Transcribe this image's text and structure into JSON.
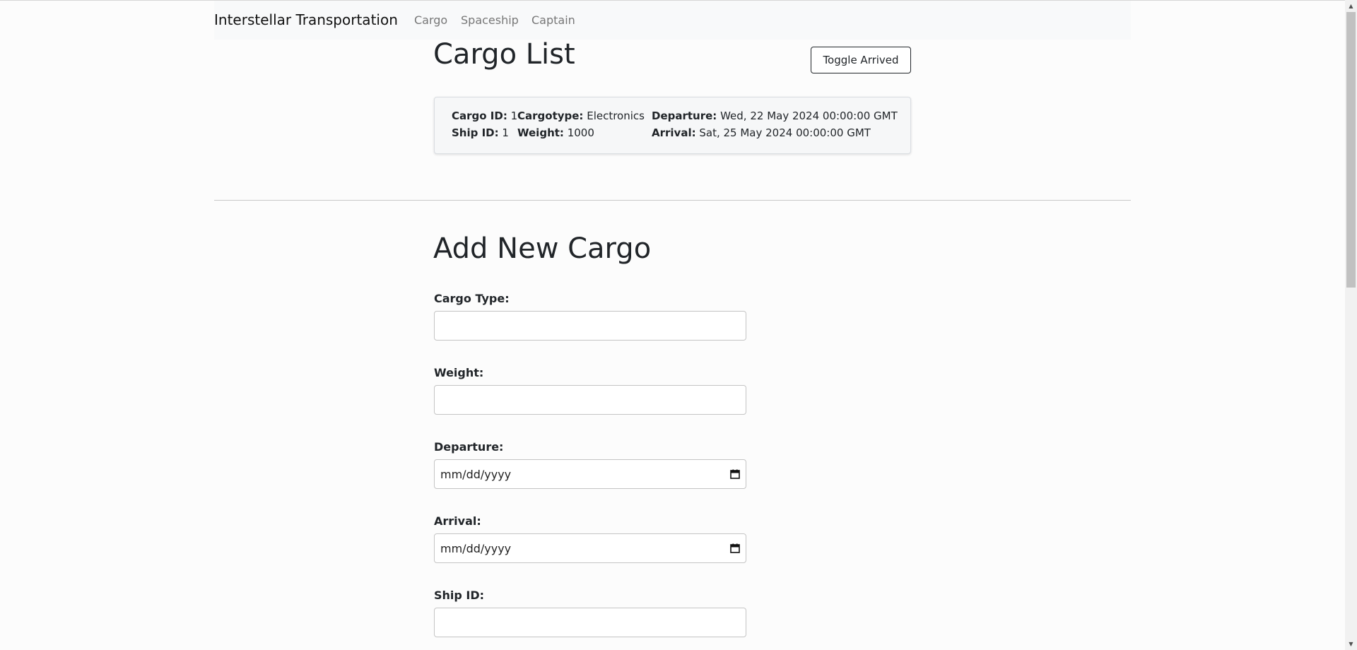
{
  "navbar": {
    "brand": "Interstellar Transportation",
    "links": [
      "Cargo",
      "Spaceship",
      "Captain"
    ]
  },
  "cargo_list": {
    "title": "Cargo List",
    "toggle_label": "Toggle Arrived",
    "items": [
      {
        "cargo_id_label": "Cargo ID:",
        "cargo_id": "1",
        "ship_id_label": "Ship ID:",
        "ship_id": "1",
        "cargotype_label": "Cargotype:",
        "cargotype": "Electronics",
        "weight_label": "Weight:",
        "weight": "1000",
        "departure_label": "Departure:",
        "departure": "Wed, 22 May 2024 00:00:00 GMT",
        "arrival_label": "Arrival:",
        "arrival": "Sat, 25 May 2024 00:00:00 GMT"
      }
    ]
  },
  "add_cargo": {
    "title": "Add New Cargo",
    "cargo_type_label": "Cargo Type:",
    "cargo_type_value": "",
    "weight_label": "Weight:",
    "weight_value": "",
    "departure_label": "Departure:",
    "departure_placeholder": "mm/dd/yyyy",
    "arrival_label": "Arrival:",
    "arrival_placeholder": "mm/dd/yyyy",
    "ship_id_label": "Ship ID:",
    "ship_id_value": ""
  },
  "icons": {
    "calendar": "calendar-icon"
  }
}
